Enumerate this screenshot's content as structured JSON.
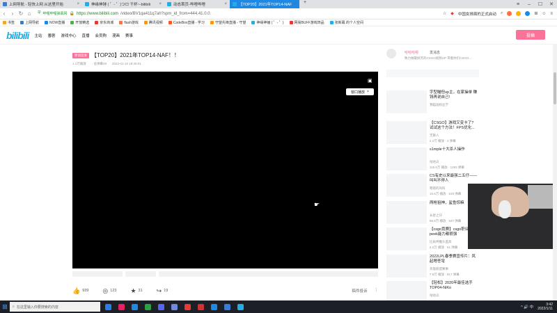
{
  "browser": {
    "tabs": [
      {
        "label": "上网导航 - 轻快上网 从这里开始",
        "color": "#3a7bd5",
        "active": false
      },
      {
        "label": "神缘神锤 ( ゜- ゜)つロ 干杯~-bilibili",
        "color": "#23ade5",
        "active": false
      },
      {
        "label": "动态首页-哔哩哔哩",
        "color": "#23ade5",
        "active": false
      },
      {
        "label": "【TOP20】2021年TOP14-NAF",
        "color": "#23ade5",
        "active": true
      }
    ],
    "new_tab": "+",
    "site_label": "哔哩哔哩弹幕网",
    "url": "https://www.bilibili.com",
    "url_rest": "/video/BV1qa411q7ah?spm_id_from=444.41.0.0",
    "hint_text": "中国女排面的正式启动",
    "bookmarks": [
      {
        "label": "书签",
        "color": "#f5a623"
      },
      {
        "label": "上网导航",
        "color": "#3a7bd5"
      },
      {
        "label": "NOW直播",
        "color": "#1e88e5"
      },
      {
        "label": "开放精选",
        "color": "#4caf50"
      },
      {
        "label": "京东商城",
        "color": "#e53935"
      },
      {
        "label": "flash游戏",
        "color": "#ff7043"
      },
      {
        "label": "腾讯视频",
        "color": "#ff9800"
      },
      {
        "label": "CodeBox直播 - 学习",
        "color": "#ff5722"
      },
      {
        "label": "守望先锋直播 - 守望",
        "color": "#ff9800"
      },
      {
        "label": "神缘神锤 ( ゜- ゜)",
        "color": "#23ade5"
      },
      {
        "label": "网易BUFF游戏饰品",
        "color": "#e53935"
      },
      {
        "label": "张新幕 的个人空间",
        "color": "#23ade5"
      }
    ]
  },
  "bili": {
    "logo": "bilibili",
    "nav": [
      "主站",
      "番剧",
      "游戏中心",
      "直播",
      "会员购",
      "漫画",
      "赛事"
    ],
    "post_button": "投稿"
  },
  "video": {
    "tag": "原创首发",
    "title": "【TOP20】2021年TOP14-NAF！！",
    "meta": [
      "1.1万播放",
      "· 总弹幕28",
      "2022-01-10 19:45:01"
    ],
    "mini_label": "窗口播放",
    "mini_close": "×",
    "actions": [
      {
        "icon": "like-icon",
        "glyph": "👍",
        "value": "939"
      },
      {
        "icon": "coin-icon",
        "glyph": "◎",
        "value": "123"
      },
      {
        "icon": "star-icon",
        "glyph": "★",
        "value": "31"
      },
      {
        "icon": "share-icon",
        "glyph": "↪",
        "value": "19"
      }
    ],
    "actions_right": [
      "稿件投诉",
      "⋮"
    ]
  },
  "up": {
    "name": "哈哈哈嗯",
    "message": "发消息",
    "desc": "致力做最搞笑的CSGO视频UP 带着你们CSGO..."
  },
  "recommendations": [
    {
      "title": "字型瞄但up主，在家操单 赚钱再说自己!",
      "up": "我瞄准粉丝学",
      "stats": ""
    },
    {
      "title": "【CSGO】游戏又变卡了? 试试这个方法！FPS优化...",
      "up": "无聊人",
      "stats": "2.2万 播放 · 4 弹幕"
    },
    {
      "title": "s1mple十大杀人操作",
      "up": "咕咕瓜",
      "stats": "115.6万 播放 · 1293 弹幕"
    },
    {
      "title": "CS有史以来最强二五仔——叫叫不停人",
      "up": "嗯嗯的叫叫",
      "stats": "16.6万 播放 · 519 弹幕"
    },
    {
      "title": "两枪狙神，鲨鱼惊嘛",
      "up": "长星之仔",
      "stats": "56.8万 播放 · 647 弹幕"
    },
    {
      "title": "【csgo竟赛】csgo职业选手peek能力都很强",
      "up": "比肩神魔头面具",
      "stats": "4.2万 播放 · 51 弹幕"
    },
    {
      "title": "2022LPL春季赛宣传片：风起嗯苍穹",
      "up": "英雄联盟赛事",
      "stats": "7.5万 播放 · 817 弹幕"
    },
    {
      "title": "【轻松】2020年最佳选手TOP04-NiKo",
      "up": "咕咕瓜",
      "stats": ""
    }
  ],
  "taskbar": {
    "search_placeholder": "在这里输入你要搜索的内容",
    "apps": [
      "#2b7de9",
      "#e91e63",
      "#1e88e5",
      "#2ea043",
      "#5865f2",
      "#7289da",
      "#e53935",
      "#cc3333",
      "#1e88e5",
      "#3a7bd5",
      "#23ade5"
    ],
    "tray": "^ 🔊 中",
    "time": "3:42",
    "date": "2022/1/11"
  }
}
